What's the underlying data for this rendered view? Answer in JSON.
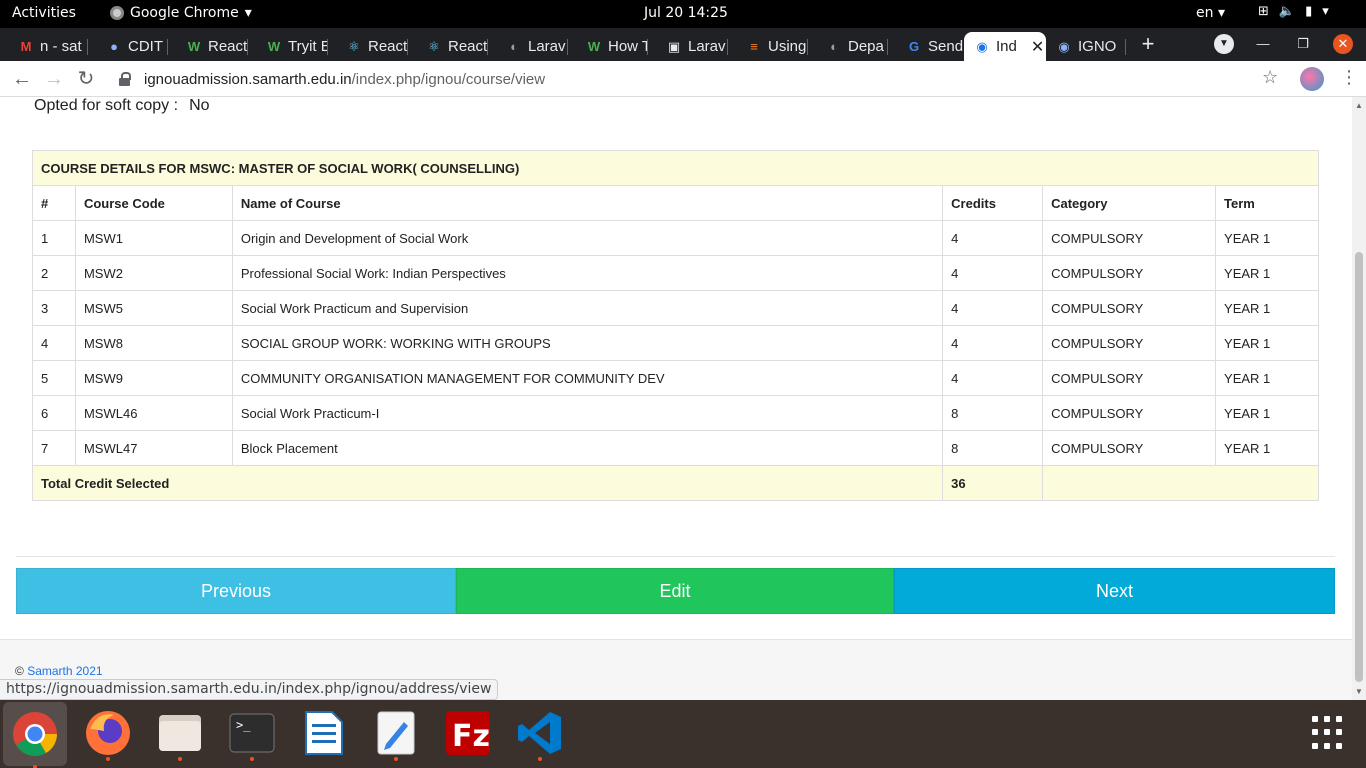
{
  "topbar": {
    "activities": "Activities",
    "app_name": "Google Chrome",
    "clock": "Jul 20  14:25",
    "lang": "en"
  },
  "tabs": [
    {
      "label": "n - sat",
      "icon": "gmail-icon"
    },
    {
      "label": "CDIT \\",
      "icon": "globe-icon"
    },
    {
      "label": "React",
      "icon": "w-icon"
    },
    {
      "label": "Tryit E",
      "icon": "w-icon"
    },
    {
      "label": "React",
      "icon": "react-icon"
    },
    {
      "label": "React",
      "icon": "react-icon"
    },
    {
      "label": "Larav",
      "icon": "globe-icon"
    },
    {
      "label": "How T",
      "icon": "w-icon"
    },
    {
      "label": "Larav",
      "icon": "laravel-icon"
    },
    {
      "label": "Using",
      "icon": "stackoverflow-icon"
    },
    {
      "label": "Depa",
      "icon": "globe-icon"
    },
    {
      "label": "Send",
      "icon": "google-icon"
    },
    {
      "label": "Ind",
      "icon": "ignou-icon",
      "active": true
    },
    {
      "label": "IGNO",
      "icon": "ignou-icon"
    }
  ],
  "address": {
    "host": "ignouadmission.samarth.edu.in",
    "path": "/index.php/ignou/course/view"
  },
  "page": {
    "softcopy_label": "Opted for soft copy :",
    "softcopy_value": "No",
    "table_caption": "COURSE DETAILS FOR MSWC: MASTER OF SOCIAL WORK( COUNSELLING)",
    "headers": [
      "#",
      "Course Code",
      "Name of Course",
      "Credits",
      "Category",
      "Term"
    ],
    "rows": [
      [
        "1",
        "MSW1",
        "Origin and Development of Social Work",
        "4",
        "COMPULSORY",
        "YEAR 1"
      ],
      [
        "2",
        "MSW2",
        "Professional Social Work: Indian Perspectives",
        "4",
        "COMPULSORY",
        "YEAR 1"
      ],
      [
        "3",
        "MSW5",
        "Social Work Practicum and Supervision",
        "4",
        "COMPULSORY",
        "YEAR 1"
      ],
      [
        "4",
        "MSW8",
        "SOCIAL GROUP WORK: WORKING WITH GROUPS",
        "4",
        "COMPULSORY",
        "YEAR 1"
      ],
      [
        "5",
        "MSW9",
        "COMMUNITY ORGANISATION MANAGEMENT FOR COMMUNITY DEV",
        "4",
        "COMPULSORY",
        "YEAR 1"
      ],
      [
        "6",
        "MSWL46",
        "Social Work Practicum-I",
        "8",
        "COMPULSORY",
        "YEAR 1"
      ],
      [
        "7",
        "MSWL47",
        "Block Placement",
        "8",
        "COMPULSORY",
        "YEAR 1"
      ]
    ],
    "total_label": "Total Credit Selected",
    "total_value": "36",
    "buttons": {
      "previous": "Previous",
      "edit": "Edit",
      "next": "Next"
    },
    "footer_prefix": "©",
    "footer_link": "Samarth 2021",
    "status_url": "https://ignouadmission.samarth.edu.in/index.php/ignou/address/view"
  },
  "dock": [
    "chrome-icon",
    "firefox-icon",
    "files-icon",
    "terminal-icon",
    "writer-icon",
    "text-editor-icon",
    "filezilla-icon",
    "vscode-icon"
  ],
  "colors": {
    "btn_previous": "#3dc0e4",
    "btn_edit": "#20c65c",
    "btn_next": "#01aad8",
    "highlight_row": "#fcfcdc"
  }
}
